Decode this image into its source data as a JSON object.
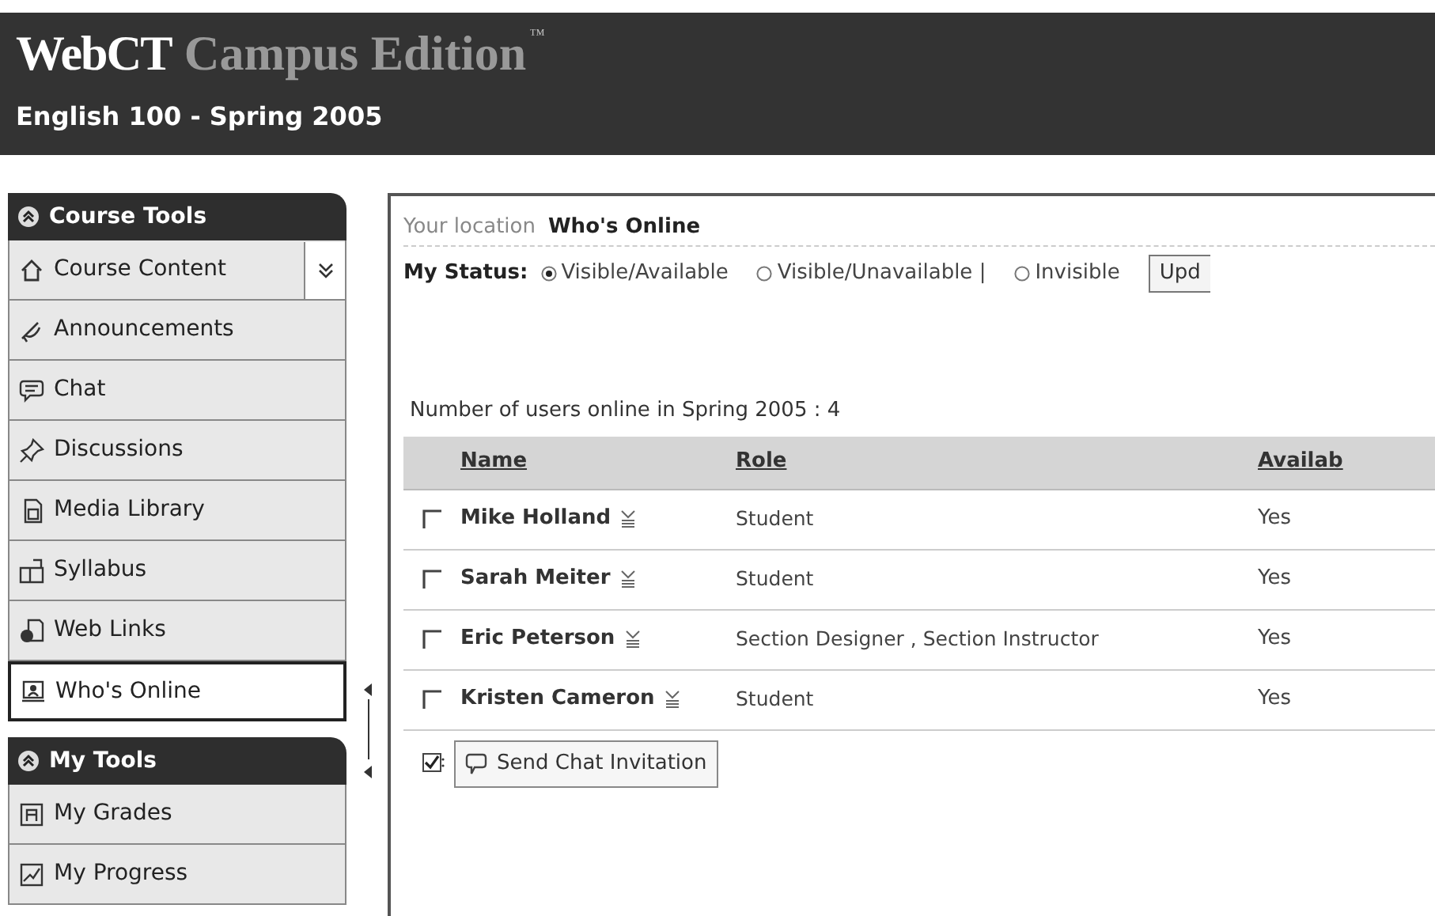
{
  "header": {
    "brand": "WebCT",
    "product": "Campus Edition",
    "trademark": "™",
    "course": "English 100 - Spring 2005"
  },
  "sidebar": [
    {
      "title": "Course Tools",
      "expanded": true,
      "items": [
        {
          "label": "Course Content",
          "selected": false,
          "menu": true
        },
        {
          "label": "Announcements",
          "selected": false
        },
        {
          "label": "Chat",
          "selected": false
        },
        {
          "label": "Discussions",
          "selected": false
        },
        {
          "label": "Media Library",
          "selected": false
        },
        {
          "label": "Syllabus",
          "selected": false
        },
        {
          "label": "Web Links",
          "selected": false
        },
        {
          "label": "Who's Online",
          "selected": true
        }
      ]
    },
    {
      "title": "My Tools",
      "expanded": true,
      "items": [
        {
          "label": "My Grades",
          "selected": false
        },
        {
          "label": "My Progress",
          "selected": false
        }
      ]
    }
  ],
  "location": {
    "label": "Your location",
    "current": "Who's Online"
  },
  "status": {
    "label": "My Status:",
    "options": [
      {
        "label": "Visible/Available",
        "selected": true
      },
      {
        "label": "Visible/Unavailable |",
        "selected": false
      },
      {
        "label": "Invisible",
        "selected": false
      }
    ],
    "button": "Upd"
  },
  "summary": "Number of users online in Spring 2005 : 4",
  "table": {
    "columns": [
      "Name",
      "Role",
      "Availab"
    ],
    "rows": [
      {
        "name": "Mike Holland",
        "role": "Student",
        "available": "Yes",
        "checked": false
      },
      {
        "name": "Sarah Meiter",
        "role": "Student",
        "available": "Yes",
        "checked": false
      },
      {
        "name": "Eric Peterson",
        "role": "Section Designer , Section Instructor",
        "available": "Yes",
        "checked": false
      },
      {
        "name": "Kristen Cameron",
        "role": "Student",
        "available": "Yes",
        "checked": false
      }
    ]
  },
  "action_button": "Send Chat Invitation"
}
